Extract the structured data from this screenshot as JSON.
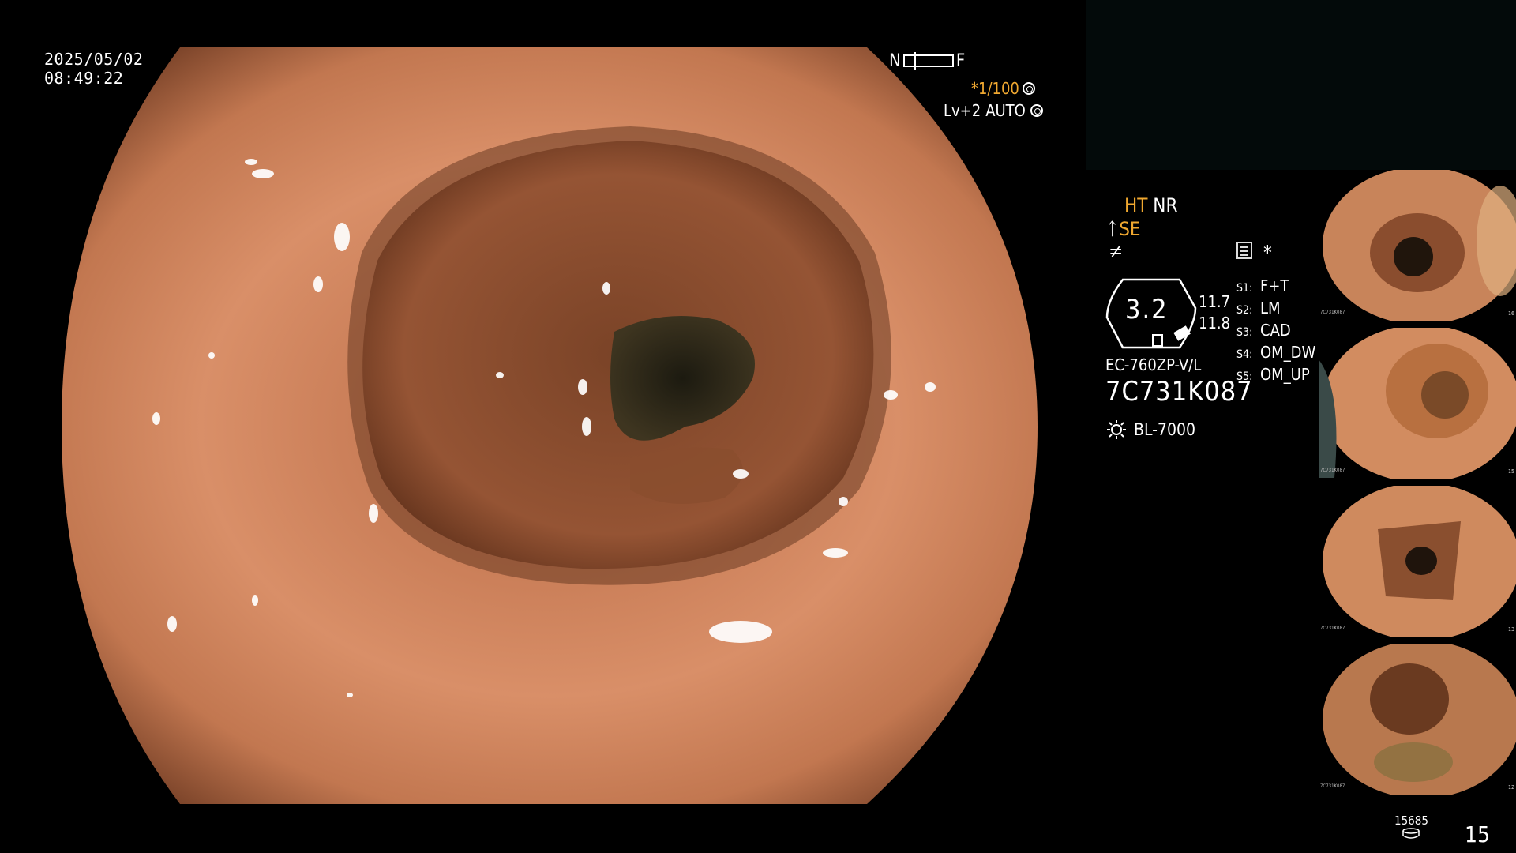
{
  "overlay": {
    "date": "2025/05/02",
    "time": "08:49:22",
    "near_label": "N",
    "far_label": "F",
    "shutter": "*1/100",
    "level": "Lv+2",
    "mode": "AUTO"
  },
  "panel": {
    "ht": "HT",
    "nr": "NR",
    "se": "SE",
    "f_symbol": "≠",
    "asterisk": "*",
    "gauge_value": "3.2",
    "num_a": "11.7",
    "num_b": "11.8",
    "slots": [
      {
        "key": "S1:",
        "label": "F+T"
      },
      {
        "key": "S2:",
        "label": "LM"
      },
      {
        "key": "S3:",
        "label": "CAD"
      },
      {
        "key": "S4:",
        "label": "OM_DW"
      },
      {
        "key": "S5:",
        "label": "OM_UP"
      }
    ],
    "scope_model": "EC-760ZP-V/L",
    "serial": "7C731K087",
    "light_source": "BL-7000"
  },
  "thumbnails": [
    {
      "id": "thumb-1",
      "serial": "7C731K087",
      "number": "16"
    },
    {
      "id": "thumb-2",
      "serial": "7C731K087",
      "number": "15"
    },
    {
      "id": "thumb-3",
      "serial": "7C731K087",
      "number": "13"
    },
    {
      "id": "thumb-4",
      "serial": "7C731K087",
      "number": "12"
    }
  ],
  "footer": {
    "image_count": "15685",
    "page": "15"
  },
  "colors": {
    "accent_orange": "#f0a830",
    "tissue_light": "#d9936a",
    "tissue_dark": "#4a2a18"
  }
}
